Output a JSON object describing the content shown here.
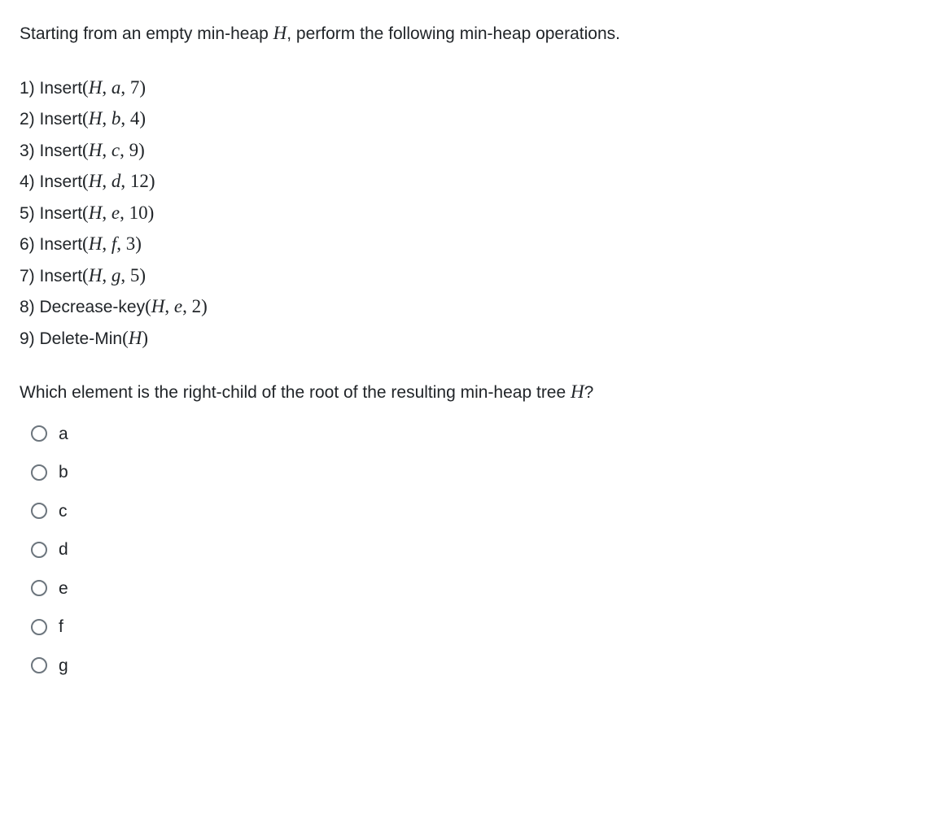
{
  "intro_parts": {
    "p1": "Starting from an empty min-heap ",
    "H": "H",
    "p2": ", perform the following min-heap operations."
  },
  "operations": [
    {
      "num": "1) ",
      "fn": "Insert",
      "lp": "(",
      "H": "H",
      "c1": ", ",
      "elem": "a",
      "c2": ", ",
      "val": "7",
      "rp": ")"
    },
    {
      "num": "2) ",
      "fn": "Insert",
      "lp": "(",
      "H": "H",
      "c1": ", ",
      "elem": "b",
      "c2": ", ",
      "val": "4",
      "rp": ")"
    },
    {
      "num": "3) ",
      "fn": "Insert",
      "lp": "(",
      "H": "H",
      "c1": ", ",
      "elem": "c",
      "c2": ", ",
      "val": "9",
      "rp": ")"
    },
    {
      "num": "4) ",
      "fn": "Insert",
      "lp": "(",
      "H": "H",
      "c1": ", ",
      "elem": "d",
      "c2": ", ",
      "val": "12",
      "rp": ")"
    },
    {
      "num": "5) ",
      "fn": "Insert",
      "lp": "(",
      "H": "H",
      "c1": ", ",
      "elem": "e",
      "c2": ", ",
      "val": "10",
      "rp": ")"
    },
    {
      "num": "6) ",
      "fn": "Insert",
      "lp": "(",
      "H": "H",
      "c1": ", ",
      "elem": "f",
      "c2": ", ",
      "val": "3",
      "rp": ")"
    },
    {
      "num": "7) ",
      "fn": "Insert",
      "lp": "(",
      "H": "H",
      "c1": ", ",
      "elem": "g",
      "c2": ", ",
      "val": "5",
      "rp": ")"
    },
    {
      "num": "8) ",
      "fn": "Decrease-key",
      "lp": "(",
      "H": "H",
      "c1": ", ",
      "elem": "e",
      "c2": ", ",
      "val": "2",
      "rp": ")"
    },
    {
      "num": "9) ",
      "fn": "Delete-Min",
      "lp": "(",
      "H": "H",
      "c1": "",
      "elem": "",
      "c2": "",
      "val": "",
      "rp": ")"
    }
  ],
  "question_parts": {
    "p1": "Which element is the right-child of the root of the resulting min-heap tree ",
    "H": "H",
    "p2": "?"
  },
  "options": [
    {
      "label": "a"
    },
    {
      "label": "b"
    },
    {
      "label": "c"
    },
    {
      "label": "d"
    },
    {
      "label": "e"
    },
    {
      "label": "f"
    },
    {
      "label": "g"
    }
  ]
}
